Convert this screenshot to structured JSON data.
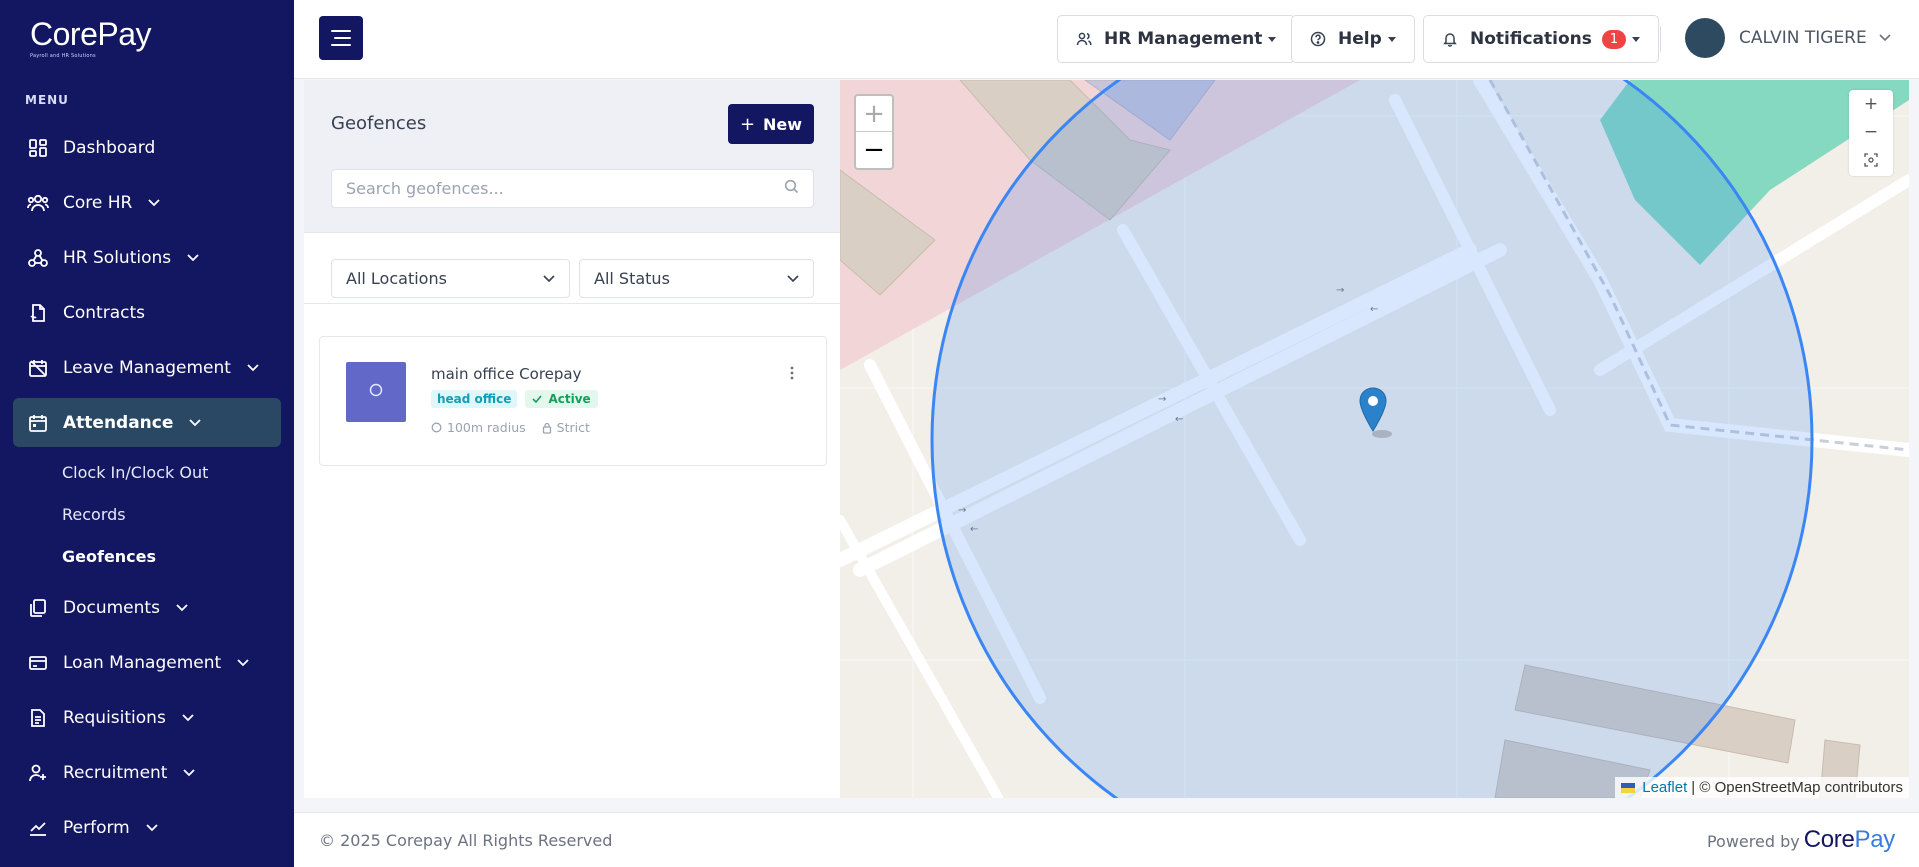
{
  "brand": {
    "name": "CorePay",
    "tagline": "Payroll and HR Solutions"
  },
  "sidebar": {
    "menu_heading": "MENU",
    "items": [
      {
        "label": "Dashboard",
        "icon": "dashboard-icon",
        "expandable": false
      },
      {
        "label": "Core HR",
        "icon": "users-icon",
        "expandable": true
      },
      {
        "label": "HR Solutions",
        "icon": "network-icon",
        "expandable": true
      },
      {
        "label": "Contracts",
        "icon": "contract-icon",
        "expandable": false
      },
      {
        "label": "Leave Management",
        "icon": "calendar-off-icon",
        "expandable": true
      },
      {
        "label": "Attendance",
        "icon": "calendar-icon",
        "expandable": true,
        "active": true
      },
      {
        "label": "Documents",
        "icon": "documents-icon",
        "expandable": true
      },
      {
        "label": "Loan Management",
        "icon": "card-icon",
        "expandable": true
      },
      {
        "label": "Requisitions",
        "icon": "file-list-icon",
        "expandable": true
      },
      {
        "label": "Recruitment",
        "icon": "user-plus-icon",
        "expandable": true
      },
      {
        "label": "Perform",
        "icon": "chart-line-icon",
        "expandable": true
      }
    ],
    "attendance_sub": [
      {
        "label": "Clock In/Clock Out"
      },
      {
        "label": "Records"
      },
      {
        "label": "Geofences",
        "active": true
      }
    ]
  },
  "header": {
    "hr_menu": "HR Management",
    "help": "Help",
    "notifications": "Notifications",
    "notif_count": "1",
    "user_name": "CALVIN TIGERE"
  },
  "geofences": {
    "title": "Geofences",
    "new_label": "New",
    "search_placeholder": "Search geofences...",
    "filter_location": "All Locations",
    "filter_status": "All Status",
    "items": [
      {
        "thumb": "O",
        "name": "main office Corepay",
        "type": "head office",
        "status": "Active",
        "radius": "100m radius",
        "mode": "Strict"
      }
    ]
  },
  "map": {
    "zoom_in": "+",
    "zoom_out": "−",
    "attribution_link": "Leaflet",
    "attribution_text": "| © OpenStreetMap contributors"
  },
  "footer": {
    "copyright": "© 2025 Corepay All Rights Reserved",
    "powered_by": "Powered by",
    "powered_logo_a": "Core",
    "powered_logo_b": "Pay"
  },
  "colors": {
    "sidebar": "#131660",
    "accent": "#131660",
    "active_item": "#2a4763",
    "geofence_circle": "#3a86f5"
  }
}
